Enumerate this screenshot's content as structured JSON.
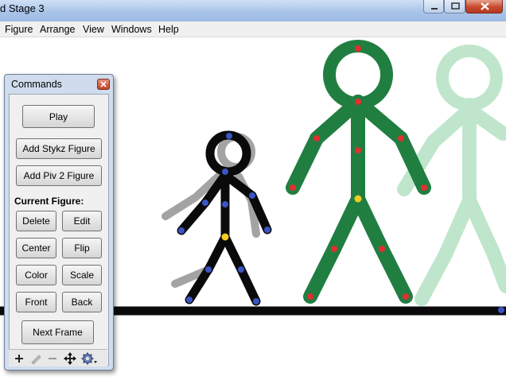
{
  "window": {
    "title": "d Stage 3"
  },
  "menu": {
    "items": [
      "Figure",
      "Arrange",
      "View",
      "Windows",
      "Help"
    ]
  },
  "commands": {
    "title": "Commands",
    "play": "Play",
    "add_stykz": "Add Stykz Figure",
    "add_piv2": "Add Piv 2 Figure",
    "current_figure_label": "Current Figure:",
    "delete": "Delete",
    "edit": "Edit",
    "center": "Center",
    "flip": "Flip",
    "color": "Color",
    "scale": "Scale",
    "front": "Front",
    "back": "Back",
    "next_frame": "Next Frame",
    "toolbar_icons": [
      "plus-icon",
      "pencil-icon",
      "minus-icon",
      "move-arrows-icon",
      "gear-icon"
    ]
  },
  "colors": {
    "black_figure": "#0a0a0a",
    "green_figure": "#217e41",
    "faded_figure": "#bfe6cc",
    "shadow": "#9a9a9a",
    "joint_blue": "#3b55c4",
    "joint_red": "#e03030",
    "joint_yellow": "#f2cc20",
    "ground": "#0a0a0a"
  }
}
